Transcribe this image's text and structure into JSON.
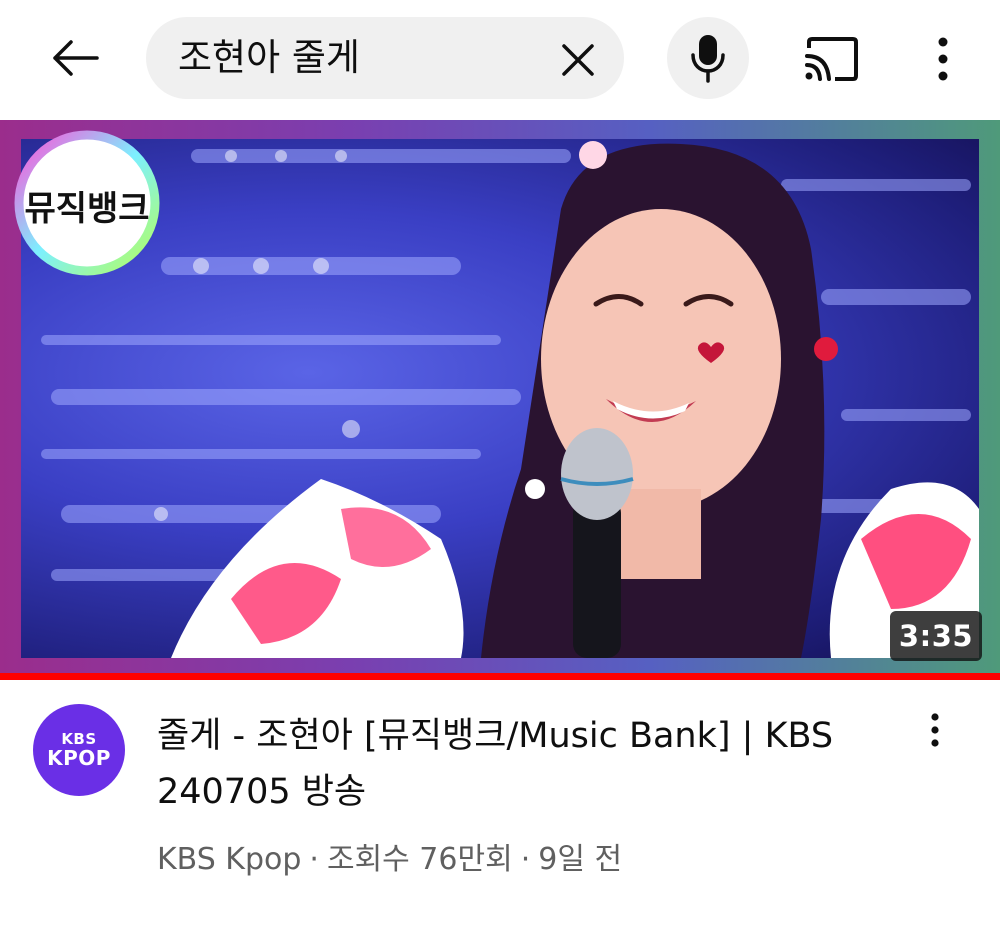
{
  "search": {
    "query": "조현아 줄게"
  },
  "icons": {
    "back": "arrow-back-icon",
    "clear": "close-icon",
    "mic": "microphone-icon",
    "cast": "cast-icon",
    "more": "more-vertical-icon"
  },
  "video": {
    "duration": "3:35",
    "progress_percent": 100,
    "title": "줄게 - 조현아 [뮤직뱅크/Music Bank] | KBS 240705 방송",
    "channel": "KBS Kpop",
    "views": "조회수 76만회",
    "age": "9일 전",
    "meta_separator": "·",
    "thumbnail_logo_text": "뮤직뱅크",
    "channel_avatar": {
      "line1": "KBS",
      "line2": "KPOP",
      "color": "#6a2fe6"
    }
  },
  "colors": {
    "progress": "#ff0000",
    "search_bg": "#f0f0f0",
    "meta_text": "#606060"
  }
}
